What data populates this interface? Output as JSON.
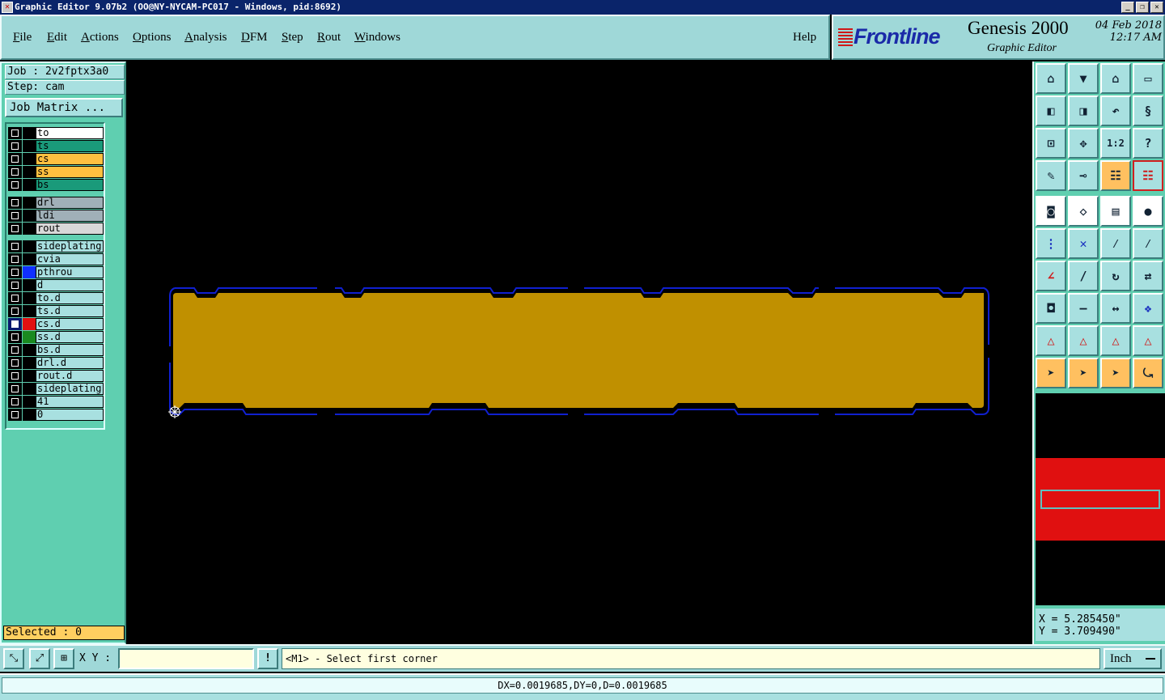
{
  "window": {
    "title": "Graphic Editor 9.07b2 (OO@NY-NYCAM-PC017 - Windows, pid:8692)",
    "controls": [
      "_",
      "❐",
      "✕"
    ]
  },
  "menu": {
    "items": [
      {
        "label": "File",
        "underline": "F",
        "rest": "ile"
      },
      {
        "label": "Edit",
        "underline": "E",
        "rest": "dit"
      },
      {
        "label": "Actions",
        "underline": "A",
        "rest": "ctions"
      },
      {
        "label": "Options",
        "underline": "O",
        "rest": "ptions"
      },
      {
        "label": "Analysis",
        "underline": "A",
        "rest": "nalysis"
      },
      {
        "label": "DFM",
        "underline": "D",
        "rest": "FM"
      },
      {
        "label": "Step",
        "underline": "S",
        "rest": "tep"
      },
      {
        "label": "Rout",
        "underline": "R",
        "rest": "out"
      },
      {
        "label": "Windows",
        "underline": "W",
        "rest": "indows"
      }
    ],
    "help": "Help"
  },
  "logo": {
    "brand": "Frontline",
    "product": "Genesis 2000",
    "subtitle": "Graphic Editor",
    "date": "04 Feb 2018",
    "time": "12:17 AM"
  },
  "job": {
    "job_label": "Job : 2v2fptx3a0",
    "step_label": "Step: cam",
    "matrix_button": "Job Matrix ..."
  },
  "layers": [
    {
      "name": "to",
      "color": "#ffffff",
      "swatch": "#000000",
      "checked": false,
      "group": 0
    },
    {
      "name": "ts",
      "color": "#1a9a7a",
      "swatch": "#000000",
      "checked": false,
      "group": 0
    },
    {
      "name": "cs",
      "color": "#ffc040",
      "swatch": "#000000",
      "checked": false,
      "group": 0
    },
    {
      "name": "ss",
      "color": "#ffc040",
      "swatch": "#000000",
      "checked": false,
      "group": 0
    },
    {
      "name": "bs",
      "color": "#1a9a7a",
      "swatch": "#000000",
      "checked": false,
      "group": 0
    },
    {
      "name": "drl",
      "color": "#a0b0b8",
      "swatch": "#000000",
      "checked": false,
      "group": 1
    },
    {
      "name": "ldi",
      "color": "#a0b0b8",
      "swatch": "#000000",
      "checked": false,
      "group": 1
    },
    {
      "name": "rout",
      "color": "#d8d8d8",
      "swatch": "#000000",
      "checked": false,
      "group": 1
    },
    {
      "name": "sideplating",
      "color": "#a8e0e0",
      "swatch": "#000000",
      "checked": false,
      "group": 2
    },
    {
      "name": "cvia",
      "color": "#a8e0e0",
      "swatch": "#000000",
      "checked": false,
      "group": 2
    },
    {
      "name": "pthrou",
      "color": "#a8e0e0",
      "swatch": "#1030ff",
      "checked": false,
      "group": 2
    },
    {
      "name": "d",
      "color": "#a8e0e0",
      "swatch": "#000000",
      "checked": false,
      "group": 2
    },
    {
      "name": "to.d",
      "color": "#a8e0e0",
      "swatch": "#000000",
      "checked": false,
      "group": 2
    },
    {
      "name": "ts.d",
      "color": "#a8e0e0",
      "swatch": "#000000",
      "checked": false,
      "group": 2
    },
    {
      "name": "cs.d",
      "color": "#a8e0e0",
      "swatch": "#e01010",
      "checked": true,
      "group": 2
    },
    {
      "name": "ss.d",
      "color": "#a8e0e0",
      "swatch": "#1a8a20",
      "checked": false,
      "group": 2
    },
    {
      "name": "bs.d",
      "color": "#a8e0e0",
      "swatch": "#000000",
      "checked": false,
      "group": 2
    },
    {
      "name": "drl.d",
      "color": "#a8e0e0",
      "swatch": "#000000",
      "checked": false,
      "group": 2
    },
    {
      "name": "rout.d",
      "color": "#a8e0e0",
      "swatch": "#000000",
      "checked": false,
      "group": 2
    },
    {
      "name": "sideplating",
      "color": "#a8e0e0",
      "swatch": "#000000",
      "checked": false,
      "group": 2
    },
    {
      "name": "41",
      "color": "#a8e0e0",
      "swatch": "#000000",
      "checked": false,
      "group": 2
    },
    {
      "name": "0",
      "color": "#a8e0e0",
      "swatch": "#000000",
      "checked": false,
      "group": 2
    }
  ],
  "selected": "Selected : 0",
  "toolbar": {
    "buttons": [
      {
        "name": "zoom-home-icon",
        "glyph": "⌂",
        "style": "normal"
      },
      {
        "name": "zoom-down-icon",
        "glyph": "▼",
        "style": "normal"
      },
      {
        "name": "home-icon",
        "glyph": "⌂",
        "style": "normal"
      },
      {
        "name": "window-icon",
        "glyph": "▭",
        "style": "normal"
      },
      {
        "name": "pan-left-icon",
        "glyph": "◧",
        "style": "normal"
      },
      {
        "name": "pan-right-icon",
        "glyph": "◨",
        "style": "normal"
      },
      {
        "name": "undo-icon",
        "glyph": "↶",
        "style": "normal"
      },
      {
        "name": "s-route-icon",
        "glyph": "§",
        "style": "normal"
      },
      {
        "name": "fit-screen-icon",
        "glyph": "⊡",
        "style": "normal"
      },
      {
        "name": "center-icon",
        "glyph": "✥",
        "style": "normal"
      },
      {
        "name": "scale-icon",
        "glyph": "1:2",
        "style": "normal"
      },
      {
        "name": "help-icon",
        "glyph": "?",
        "style": "normal"
      },
      {
        "name": "tools-icon",
        "glyph": "✎",
        "style": "normal"
      },
      {
        "name": "measure-icon",
        "glyph": "⊸",
        "style": "normal"
      },
      {
        "name": "display-control-icon",
        "glyph": "☷",
        "style": "orange"
      },
      {
        "name": "layer-control-icon",
        "glyph": "☷",
        "style": "red"
      },
      {
        "name": "snapshot-icon",
        "glyph": "◙",
        "style": "white"
      },
      {
        "name": "feature-icon",
        "glyph": "◇",
        "style": "white"
      },
      {
        "name": "ruler-icon",
        "glyph": "▤",
        "style": "white"
      },
      {
        "name": "pad-icon",
        "glyph": "●",
        "style": "white"
      },
      {
        "name": "connect-icon",
        "glyph": "⋮",
        "style": "normal"
      },
      {
        "name": "cross-icon",
        "glyph": "✕",
        "style": "normal"
      },
      {
        "name": "line-point-icon",
        "glyph": "⁄",
        "style": "normal"
      },
      {
        "name": "line-dot-icon",
        "glyph": "⁄",
        "style": "normal"
      },
      {
        "name": "angle-icon",
        "glyph": "∠",
        "style": "normal"
      },
      {
        "name": "diagonal-icon",
        "glyph": "/",
        "style": "normal"
      },
      {
        "name": "arc-icon",
        "glyph": "↻",
        "style": "normal"
      },
      {
        "name": "mirror-icon",
        "glyph": "⇄",
        "style": "normal"
      },
      {
        "name": "pad-place-icon",
        "glyph": "◘",
        "style": "normal"
      },
      {
        "name": "line-icon",
        "glyph": "—",
        "style": "normal"
      },
      {
        "name": "dimension-icon",
        "glyph": "↔",
        "style": "normal"
      },
      {
        "name": "group-icon",
        "glyph": "❖",
        "style": "normal"
      },
      {
        "name": "triangle-a-icon",
        "glyph": "△",
        "style": "normal"
      },
      {
        "name": "triangle-b-icon",
        "glyph": "△",
        "style": "normal"
      },
      {
        "name": "triangle-c-icon",
        "glyph": "△",
        "style": "normal"
      },
      {
        "name": "triangle-d-icon",
        "glyph": "△",
        "style": "normal"
      },
      {
        "name": "pointer-icon",
        "glyph": "➤",
        "style": "orange"
      },
      {
        "name": "pointer-box-icon",
        "glyph": "➤",
        "style": "orange"
      },
      {
        "name": "pointer-circle-icon",
        "glyph": "➤",
        "style": "orange"
      },
      {
        "name": "route-pointer-icon",
        "glyph": "⤿",
        "style": "orange"
      }
    ]
  },
  "coords": {
    "x": "X = 5.285450\"",
    "y": "Y = 3.709490\""
  },
  "bottom": {
    "xy_label": "X Y :",
    "xy_value": "",
    "bang": "!",
    "prompt": "<M1> - Select first corner",
    "units": "Inch"
  },
  "status": "DX=0.0019685,DY=0,D=0.0019685"
}
